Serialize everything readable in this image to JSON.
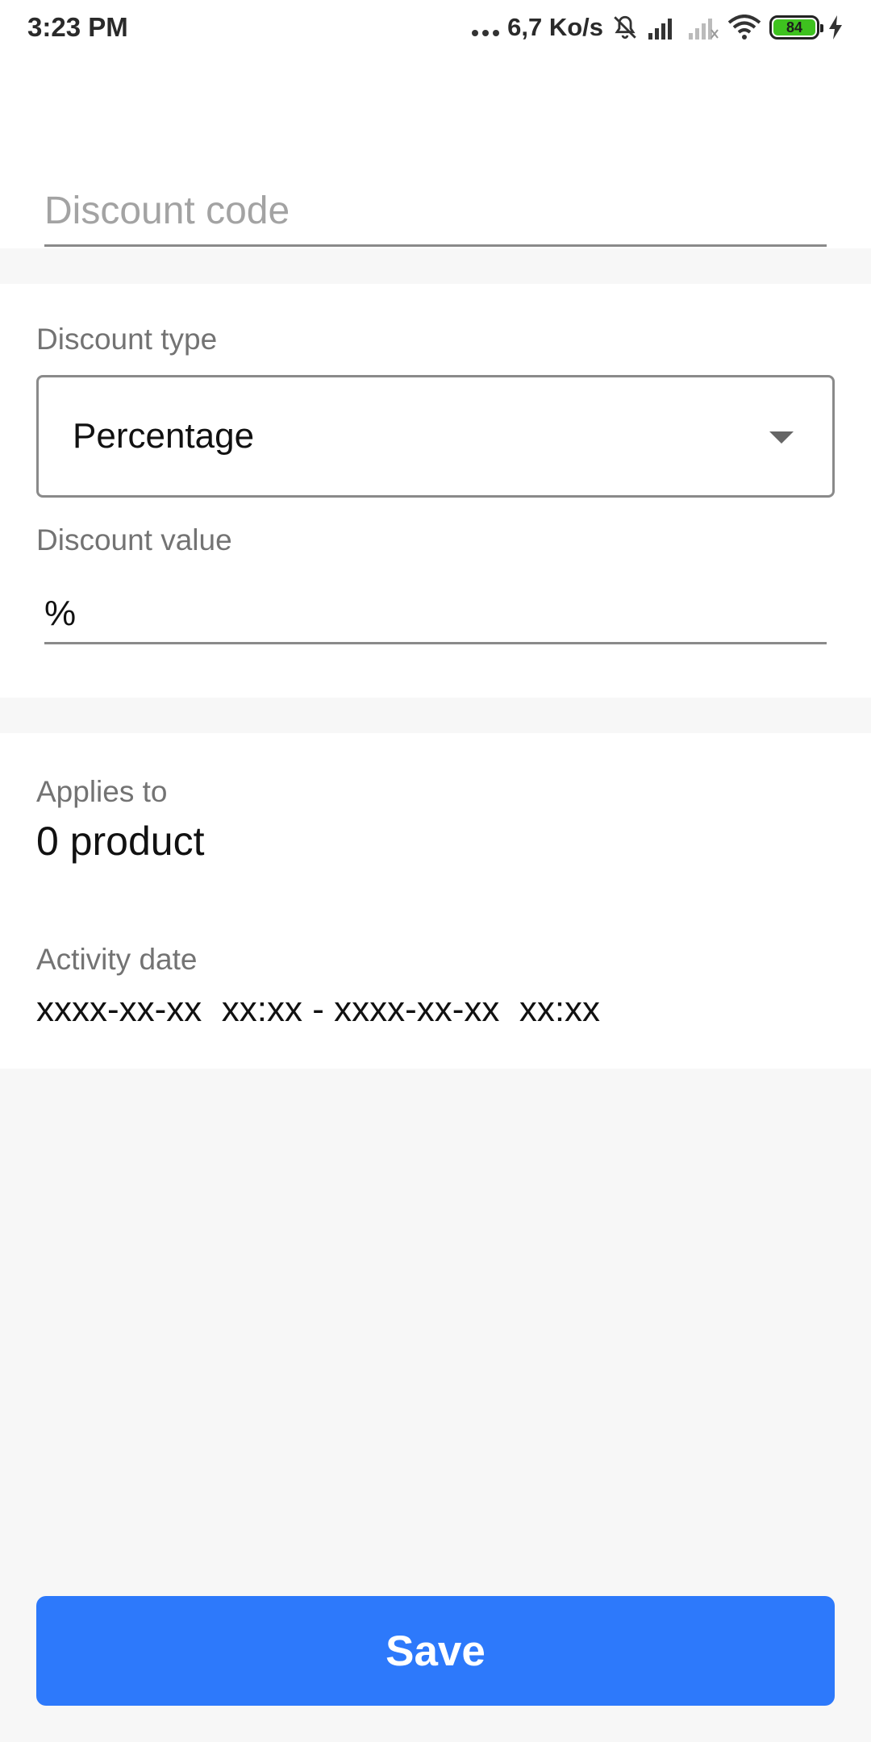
{
  "status_bar": {
    "time": "3:23 PM",
    "net_speed": "6,7 Ko/s",
    "battery": "84",
    "icons": [
      "more-dots-icon",
      "mute-bell-icon",
      "signal-icon",
      "no-signal-icon",
      "wifi-icon",
      "battery-icon",
      "charging-icon"
    ]
  },
  "discount_code": {
    "placeholder": "Discount code",
    "value": ""
  },
  "discount_type": {
    "label": "Discount type",
    "selected": "Percentage"
  },
  "discount_value": {
    "label": "Discount value",
    "value": "%"
  },
  "applies_to": {
    "label": "Applies to",
    "value": "0 product"
  },
  "activity_date": {
    "label": "Activity date",
    "value": "xxxx-xx-xx  xx:xx - xxxx-xx-xx  xx:xx"
  },
  "actions": {
    "save_label": "Save"
  },
  "colors": {
    "primary": "#2d79fb",
    "battery_fill": "#3ec21f",
    "background": "#f7f7f7"
  }
}
